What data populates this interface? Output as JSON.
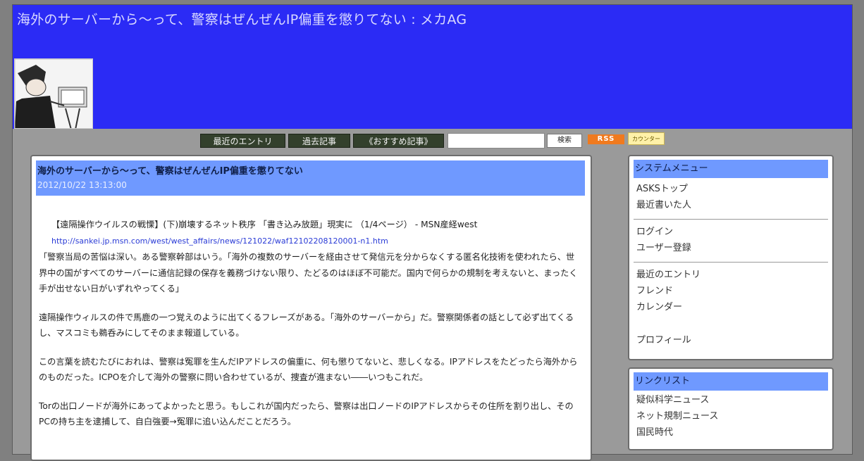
{
  "header": {
    "title": "海外のサーバーから〜って、警察はぜんぜんIP偏重を懲りてない : メカAG"
  },
  "nav": {
    "recent_entries": "最近のエントリ",
    "past_articles": "過去記事",
    "recommended": "《おすすめ記事》",
    "search_button": "検索",
    "search_value": "",
    "rss_badge": "RSS",
    "counter_badge": "カウンター"
  },
  "entry": {
    "title": "海外のサーバーから〜って、警察はぜんぜんIP偏重を懲りてない",
    "date": "2012/10/22 13:13:00",
    "quote_title": "【遠隔操作ウイルスの戦慄】(下)崩壊するネット秩序 「書き込み放題」現実に （1/4ページ） - MSN産経west",
    "link": "http://sankei.jp.msn.com/west/west_affairs/news/121022/waf12102208120001-n1.htm",
    "paragraphs": [
      "「警察当局の苦悩は深い。ある警察幹部はいう。「海外の複数のサーバーを経由させて発信元を分からなくする匿名化技術を使われたら、世界中の国がすべてのサーバーに通信記録の保存を義務づけない限り、たどるのはほぼ不可能だ。国内で何らかの規制を考えないと、まったく手が出せない日がいずれやってくる」",
      "遠隔操作ウィルスの件で馬鹿の一つ覚えのように出てくるフレーズがある。「海外のサーバーから」だ。警察関係者の話として必ず出てくるし、マスコミも鵜呑みにしてそのまま報道している。",
      "この言葉を読むたびにおれは、警察は冤罪を生んだIPアドレスの偏重に、何も懲りてないと、悲しくなる。IPアドレスをたどったら海外からのものだった。ICPOを介して海外の警察に問い合わせているが、捜査が進まない――いつもこれだ。",
      "Torの出口ノードが海外にあってよかったと思う。もしこれが国内だったら、警察は出口ノードのIPアドレスからその住所を割り出し、そのPCの持ち主を逮捕して、自白強要→冤罪に追い込んだことだろう。"
    ]
  },
  "sidebar": {
    "system_menu": {
      "title": "システムメニュー",
      "group1": [
        "ASKSトップ",
        "最近書いた人"
      ],
      "group2": [
        "ログイン",
        "ユーザー登録"
      ],
      "group3": [
        "最近のエントリ",
        "フレンド",
        "カレンダー"
      ],
      "profile": "プロフィール"
    },
    "link_list": {
      "title": "リンクリスト",
      "items": [
        "疑似科学ニュース",
        "ネット規制ニュース",
        "国民時代"
      ]
    }
  },
  "colors": {
    "header_bg": "#2b2bf5",
    "accent_bar": "#6f99ff",
    "nav_btn": "#33402c",
    "page_bg": "#808080"
  },
  "icons": [
    "header-illustration-icon",
    "rss-badge-icon",
    "counter-badge-icon"
  ]
}
